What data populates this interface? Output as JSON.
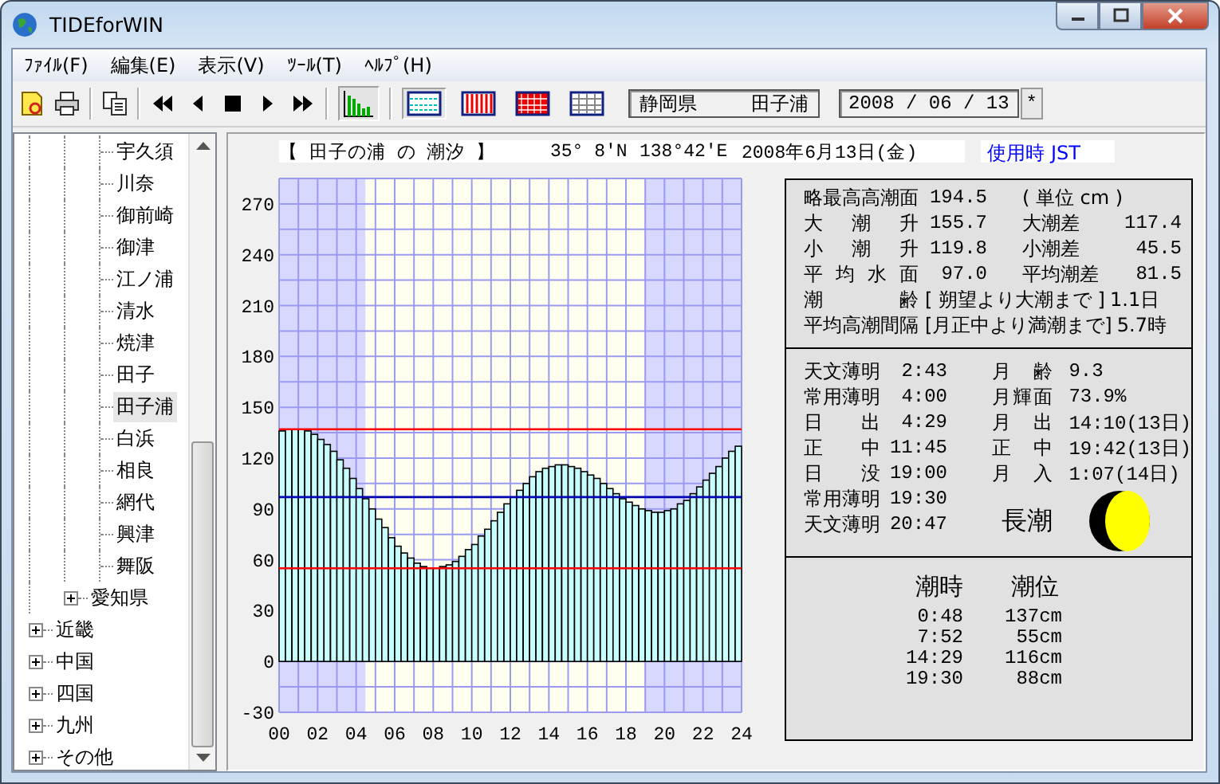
{
  "window": {
    "title": "TIDEforWIN"
  },
  "menu": [
    "ﾌｧｲﾙ(F)",
    "編集(E)",
    "表示(V)",
    "ﾂｰﾙ(T)",
    "ﾍﾙﾌﾟ(H)"
  ],
  "toolbar": {
    "chart_view_pressed": true,
    "grid_styles": [
      {
        "kind": "lines",
        "selected": true
      },
      {
        "kind": "stripes",
        "selected": false
      },
      {
        "kind": "dots",
        "selected": false
      },
      {
        "kind": "grid",
        "selected": false
      }
    ],
    "prefecture": "静岡県",
    "station": "田子浦",
    "date": "2008 / 06 / 13",
    "date_button": "*"
  },
  "tree": [
    {
      "children": [
        {
          "children": [
            {
              "label": "宇久須",
              "selected": false
            },
            {
              "label": "川奈",
              "selected": false
            },
            {
              "label": "御前崎",
              "selected": false
            },
            {
              "label": "御津",
              "selected": false
            },
            {
              "label": "江ノ浦",
              "selected": false
            },
            {
              "label": "清水",
              "selected": false
            },
            {
              "label": "焼津",
              "selected": false
            },
            {
              "label": "田子",
              "selected": false
            },
            {
              "label": "田子浦",
              "selected": true
            },
            {
              "label": "白浜",
              "selected": false
            },
            {
              "label": "相良",
              "selected": false
            },
            {
              "label": "網代",
              "selected": false
            },
            {
              "label": "興津",
              "selected": false
            },
            {
              "label": "舞阪",
              "selected": false
            }
          ]
        },
        {
          "label": "愛知県",
          "expanded": false,
          "selected": false
        }
      ]
    },
    {
      "label": "近畿",
      "expanded": false,
      "selected": false
    },
    {
      "label": "中国",
      "expanded": false,
      "selected": false
    },
    {
      "label": "四国",
      "expanded": false,
      "selected": false
    },
    {
      "label": "九州",
      "expanded": false,
      "selected": false
    },
    {
      "label": "その他",
      "expanded": false,
      "selected": false
    }
  ],
  "chart_header": {
    "title": "【 田子の浦 の 潮汐 】",
    "latitude": "35° 8'N",
    "longitude": "138°42'E",
    "date": "2008年6月13日(金)",
    "time_zone": "使用時 JST"
  },
  "chart_data": {
    "type": "bar",
    "xlim": [
      0,
      24
    ],
    "ylim": [
      -30,
      285
    ],
    "grid": true,
    "x": [
      0,
      0.33,
      0.67,
      1,
      1.33,
      1.67,
      2,
      2.33,
      2.67,
      3,
      3.33,
      3.67,
      4,
      4.33,
      4.67,
      5,
      5.33,
      5.67,
      6,
      6.33,
      6.67,
      7,
      7.33,
      7.67,
      8,
      8.33,
      8.67,
      9,
      9.33,
      9.67,
      10,
      10.33,
      10.67,
      11,
      11.33,
      11.67,
      12,
      12.33,
      12.67,
      13,
      13.33,
      13.67,
      14,
      14.33,
      14.67,
      15,
      15.33,
      15.67,
      16,
      16.33,
      16.67,
      17,
      17.33,
      17.67,
      18,
      18.33,
      18.67,
      19,
      19.33,
      19.67,
      20,
      20.33,
      20.67,
      21,
      21.33,
      21.67,
      22,
      22.33,
      22.67,
      23,
      23.33,
      23.67
    ],
    "values": [
      136,
      137,
      137,
      137,
      136,
      134,
      131,
      128,
      124,
      119,
      114,
      108,
      102,
      96,
      90,
      84,
      79,
      73,
      68,
      64,
      61,
      58,
      56,
      55,
      55,
      56,
      57,
      59,
      62,
      66,
      69,
      74,
      78,
      83,
      88,
      93,
      97,
      101,
      105,
      109,
      112,
      114,
      115,
      116,
      116,
      115,
      114,
      112,
      110,
      108,
      105,
      102,
      99,
      96,
      94,
      92,
      90,
      89,
      88,
      88,
      89,
      90,
      93,
      95,
      99,
      103,
      107,
      111,
      115,
      120,
      124,
      127
    ],
    "xticks": [
      {
        "value": 0,
        "label": "00"
      },
      {
        "value": 2,
        "label": "02"
      },
      {
        "value": 4,
        "label": "04"
      },
      {
        "value": 6,
        "label": "06"
      },
      {
        "value": 8,
        "label": "08"
      },
      {
        "value": 10,
        "label": "10"
      },
      {
        "value": 12,
        "label": "12"
      },
      {
        "value": 14,
        "label": "14"
      },
      {
        "value": 16,
        "label": "16"
      },
      {
        "value": 18,
        "label": "18"
      },
      {
        "value": 20,
        "label": "20"
      },
      {
        "value": 22,
        "label": "22"
      },
      {
        "value": 24,
        "label": "24"
      }
    ],
    "yticks": [
      -30,
      0,
      30,
      60,
      90,
      120,
      150,
      180,
      210,
      240,
      270
    ],
    "bands": [
      {
        "axis": "x",
        "from": 0,
        "to": 4.48,
        "color": "#d8d8ff"
      },
      {
        "axis": "x",
        "from": 19,
        "to": 24,
        "color": "#d8d8ff"
      }
    ],
    "ref_lines": [
      {
        "axis": "y",
        "value": 137,
        "color": "#ff0000"
      },
      {
        "axis": "y",
        "value": 55,
        "color": "#ff0000"
      },
      {
        "axis": "y",
        "value": 97,
        "color": "#0000b0"
      }
    ]
  },
  "tide_constants": {
    "rows": [
      {
        "label": "略最高高潮面",
        "value": "194.5",
        "label2": "( 単位 cm )"
      },
      {
        "label": "大 潮 升",
        "value": "155.7",
        "label2": "大潮差",
        "value2": "117.4"
      },
      {
        "label": "小 潮 升",
        "value": "119.8",
        "label2": "小潮差",
        "value2": "45.5"
      },
      {
        "label": "平 均 水 面",
        "value": "97.0",
        "label2": "平均潮差",
        "value2": "81.5"
      }
    ],
    "notes": [
      {
        "label": "潮 齢",
        "note": "[ 朔望より大潮まで ]",
        "value": "1.1日"
      },
      {
        "label": "平均高潮間隔",
        "note": "[月正中より満潮まで]",
        "value": "5.7時"
      }
    ]
  },
  "sun_moon": {
    "sun": [
      {
        "label": "天文薄明",
        "time": "2:43"
      },
      {
        "label": "常用薄明",
        "time": "4:00"
      },
      {
        "label": "日 出",
        "time": "4:29"
      },
      {
        "label": "正 中",
        "time": "11:45"
      },
      {
        "label": "日 没",
        "time": "19:00"
      },
      {
        "label": "常用薄明",
        "time": "19:30"
      },
      {
        "label": "天文薄明",
        "time": "20:47"
      }
    ],
    "moon": [
      {
        "label": "月 齢",
        "value": "9.3"
      },
      {
        "label": "月輝面",
        "value": "73.9%"
      },
      {
        "label": "月 出",
        "value": "14:10(13日)"
      },
      {
        "label": "正 中",
        "value": "19:42(13日)"
      },
      {
        "label": "月 入",
        "value": "1:07(14日)"
      }
    ],
    "tide_type": "長潮"
  },
  "tides": {
    "headers": [
      "潮時",
      "潮位"
    ],
    "rows": [
      {
        "time": "0:48",
        "level": "137cm"
      },
      {
        "time": "7:52",
        "level": "55cm"
      },
      {
        "time": "14:29",
        "level": "116cm"
      },
      {
        "time": "19:30",
        "level": "88cm"
      }
    ]
  }
}
